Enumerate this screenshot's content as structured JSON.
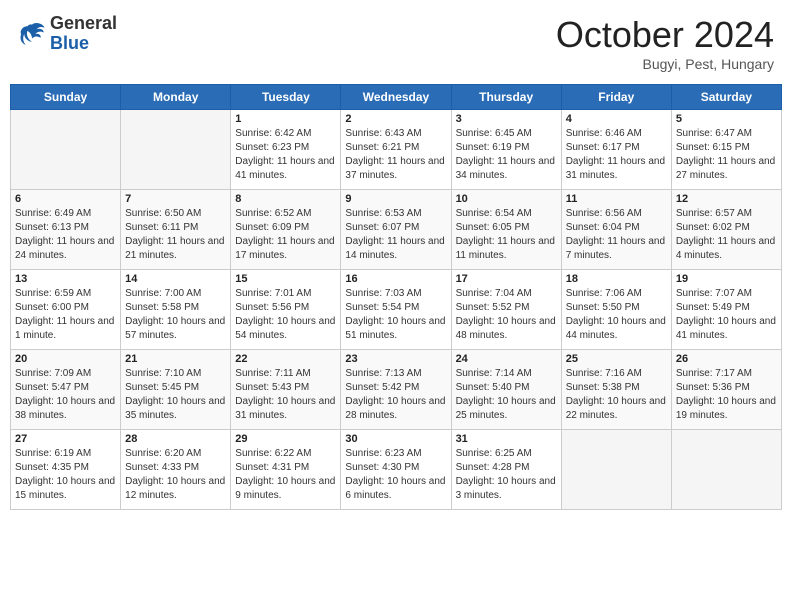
{
  "header": {
    "logo_general": "General",
    "logo_blue": "Blue",
    "month_title": "October 2024",
    "location": "Bugyi, Pest, Hungary"
  },
  "days_of_week": [
    "Sunday",
    "Monday",
    "Tuesday",
    "Wednesday",
    "Thursday",
    "Friday",
    "Saturday"
  ],
  "weeks": [
    [
      {
        "day": "",
        "info": "",
        "empty": true
      },
      {
        "day": "",
        "info": "",
        "empty": true
      },
      {
        "day": "1",
        "info": "Sunrise: 6:42 AM\nSunset: 6:23 PM\nDaylight: 11 hours and 41 minutes."
      },
      {
        "day": "2",
        "info": "Sunrise: 6:43 AM\nSunset: 6:21 PM\nDaylight: 11 hours and 37 minutes."
      },
      {
        "day": "3",
        "info": "Sunrise: 6:45 AM\nSunset: 6:19 PM\nDaylight: 11 hours and 34 minutes."
      },
      {
        "day": "4",
        "info": "Sunrise: 6:46 AM\nSunset: 6:17 PM\nDaylight: 11 hours and 31 minutes."
      },
      {
        "day": "5",
        "info": "Sunrise: 6:47 AM\nSunset: 6:15 PM\nDaylight: 11 hours and 27 minutes."
      }
    ],
    [
      {
        "day": "6",
        "info": "Sunrise: 6:49 AM\nSunset: 6:13 PM\nDaylight: 11 hours and 24 minutes."
      },
      {
        "day": "7",
        "info": "Sunrise: 6:50 AM\nSunset: 6:11 PM\nDaylight: 11 hours and 21 minutes."
      },
      {
        "day": "8",
        "info": "Sunrise: 6:52 AM\nSunset: 6:09 PM\nDaylight: 11 hours and 17 minutes."
      },
      {
        "day": "9",
        "info": "Sunrise: 6:53 AM\nSunset: 6:07 PM\nDaylight: 11 hours and 14 minutes."
      },
      {
        "day": "10",
        "info": "Sunrise: 6:54 AM\nSunset: 6:05 PM\nDaylight: 11 hours and 11 minutes."
      },
      {
        "day": "11",
        "info": "Sunrise: 6:56 AM\nSunset: 6:04 PM\nDaylight: 11 hours and 7 minutes."
      },
      {
        "day": "12",
        "info": "Sunrise: 6:57 AM\nSunset: 6:02 PM\nDaylight: 11 hours and 4 minutes."
      }
    ],
    [
      {
        "day": "13",
        "info": "Sunrise: 6:59 AM\nSunset: 6:00 PM\nDaylight: 11 hours and 1 minute."
      },
      {
        "day": "14",
        "info": "Sunrise: 7:00 AM\nSunset: 5:58 PM\nDaylight: 10 hours and 57 minutes."
      },
      {
        "day": "15",
        "info": "Sunrise: 7:01 AM\nSunset: 5:56 PM\nDaylight: 10 hours and 54 minutes."
      },
      {
        "day": "16",
        "info": "Sunrise: 7:03 AM\nSunset: 5:54 PM\nDaylight: 10 hours and 51 minutes."
      },
      {
        "day": "17",
        "info": "Sunrise: 7:04 AM\nSunset: 5:52 PM\nDaylight: 10 hours and 48 minutes."
      },
      {
        "day": "18",
        "info": "Sunrise: 7:06 AM\nSunset: 5:50 PM\nDaylight: 10 hours and 44 minutes."
      },
      {
        "day": "19",
        "info": "Sunrise: 7:07 AM\nSunset: 5:49 PM\nDaylight: 10 hours and 41 minutes."
      }
    ],
    [
      {
        "day": "20",
        "info": "Sunrise: 7:09 AM\nSunset: 5:47 PM\nDaylight: 10 hours and 38 minutes."
      },
      {
        "day": "21",
        "info": "Sunrise: 7:10 AM\nSunset: 5:45 PM\nDaylight: 10 hours and 35 minutes."
      },
      {
        "day": "22",
        "info": "Sunrise: 7:11 AM\nSunset: 5:43 PM\nDaylight: 10 hours and 31 minutes."
      },
      {
        "day": "23",
        "info": "Sunrise: 7:13 AM\nSunset: 5:42 PM\nDaylight: 10 hours and 28 minutes."
      },
      {
        "day": "24",
        "info": "Sunrise: 7:14 AM\nSunset: 5:40 PM\nDaylight: 10 hours and 25 minutes."
      },
      {
        "day": "25",
        "info": "Sunrise: 7:16 AM\nSunset: 5:38 PM\nDaylight: 10 hours and 22 minutes."
      },
      {
        "day": "26",
        "info": "Sunrise: 7:17 AM\nSunset: 5:36 PM\nDaylight: 10 hours and 19 minutes."
      }
    ],
    [
      {
        "day": "27",
        "info": "Sunrise: 6:19 AM\nSunset: 4:35 PM\nDaylight: 10 hours and 15 minutes."
      },
      {
        "day": "28",
        "info": "Sunrise: 6:20 AM\nSunset: 4:33 PM\nDaylight: 10 hours and 12 minutes."
      },
      {
        "day": "29",
        "info": "Sunrise: 6:22 AM\nSunset: 4:31 PM\nDaylight: 10 hours and 9 minutes."
      },
      {
        "day": "30",
        "info": "Sunrise: 6:23 AM\nSunset: 4:30 PM\nDaylight: 10 hours and 6 minutes."
      },
      {
        "day": "31",
        "info": "Sunrise: 6:25 AM\nSunset: 4:28 PM\nDaylight: 10 hours and 3 minutes."
      },
      {
        "day": "",
        "info": "",
        "empty": true
      },
      {
        "day": "",
        "info": "",
        "empty": true
      }
    ]
  ]
}
